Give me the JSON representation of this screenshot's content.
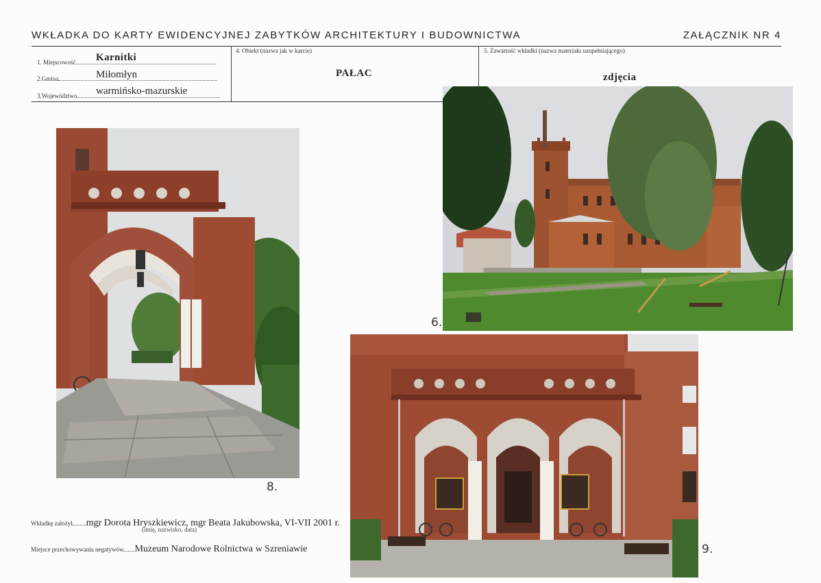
{
  "header": {
    "title": "WKŁADKA DO KARTY EWIDENCYJNEJ ZABYTKÓW ARCHITEKTURY I BUDOWNICTWA",
    "annex": "ZAŁĄCZNIK NR 4"
  },
  "fields": {
    "place_label": "1. Miejscowość",
    "place_value": "Karnitki",
    "commune_label": "2.Gmina",
    "commune_value": "Miłomłyn",
    "province_label": "3.Województwo",
    "province_value": "warmińsko-mazurskie",
    "object_label": "4. Obiekt (nazwa jak w karcie)",
    "object_value": "PAŁAC",
    "content_label": "5. Zawartość wkładki (nazwa materiału uzupełniającego)",
    "content_value": "zdjęcia"
  },
  "photos": [
    {
      "number": "6."
    },
    {
      "number": "8."
    },
    {
      "number": "9."
    }
  ],
  "footer": {
    "authors_label": "Wkładkę założył",
    "authors_value": "mgr Dorota Hryszkiewicz, mgr Beata Jakubowska, VI-VII 2001 r.",
    "authors_hint": "(imię, nazwisko, data)",
    "storage_label": "Miejsce przechowywania negatywów",
    "storage_value": "Muzeum Narodowe Rolnictwa w Szreniawie"
  },
  "colors": {
    "brick": "#9c4a33",
    "brick_dark": "#6e2f20",
    "grass": "#4f8a2f",
    "sky": "#d9dadc",
    "stone": "#9a9a94"
  }
}
